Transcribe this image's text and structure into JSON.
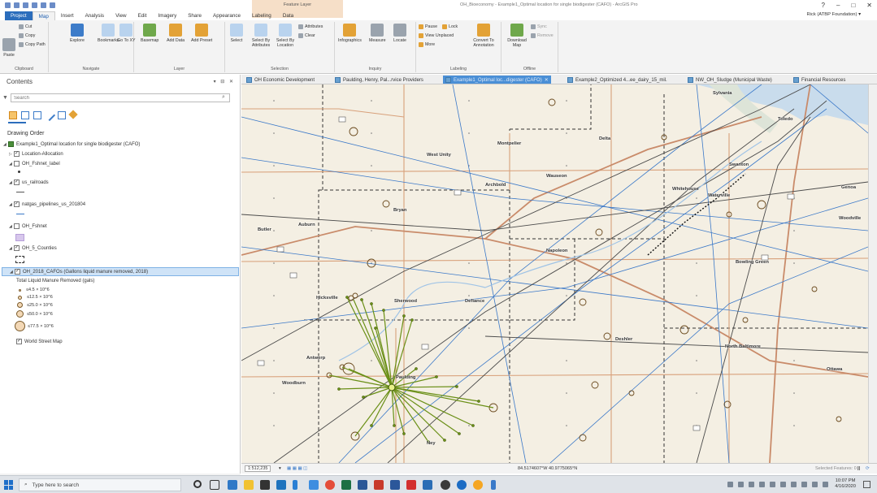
{
  "window": {
    "title": "OH_Bioeconomy - Example1_Optimal location for single biodigester (CAFO) - ArcGIS Pro",
    "context_label": "Feature Layer",
    "help": "?",
    "minimize": "–",
    "maximize": "□",
    "close": "✕"
  },
  "ribbon_tabs": [
    "Project",
    "Map",
    "Insert",
    "Analysis",
    "View",
    "Edit",
    "Imagery",
    "Share",
    "Appearance",
    "Labeling",
    "Data"
  ],
  "active_tab": "Map",
  "user": "Rick (ATBP Foundation) ▾",
  "ribbon": {
    "clipboard": {
      "label": "Clipboard",
      "paste": "Paste",
      "cut": "Cut",
      "copy": "Copy",
      "copy_path": "Copy Path"
    },
    "navigate": {
      "label": "Navigate",
      "explore": "Explore",
      "bookmarks": "Bookmarks",
      "go_to_xy": "Go To XY"
    },
    "layer": {
      "label": "Layer",
      "basemap": "Basemap",
      "add_data": "Add Data",
      "add_preset": "Add Preset"
    },
    "selection": {
      "label": "Selection",
      "select": "Select",
      "select_by_attributes": "Select By Attributes",
      "select_by_location": "Select By Location",
      "attributes": "Attributes",
      "clear": "Clear"
    },
    "inquiry": {
      "label": "Inquiry",
      "infographics": "Infographics",
      "measure": "Measure",
      "locate": "Locate"
    },
    "labeling": {
      "label": "Labeling",
      "pause": "Pause",
      "lock": "Lock",
      "view_unplaced": "View Unplaced",
      "more": "More",
      "convert": "Convert To Annotation"
    },
    "offline": {
      "label": "Offline",
      "download": "Download Map",
      "sync": "Sync",
      "remove": "Remove"
    }
  },
  "contents": {
    "title": "Contents",
    "controls": "▾ ⊟ ✕",
    "search_placeholder": "Search",
    "search_icon": "⌕",
    "drawing_order": "Drawing Order",
    "layers": [
      {
        "name": "Example1_Optimal location for single biodigester (CAFO)",
        "checked": true
      },
      {
        "name": "Location-Allocation",
        "checked": true
      },
      {
        "name": "OH_Fshnet_label",
        "checked": false
      },
      {
        "name": "us_railroads",
        "checked": true
      },
      {
        "name": "natgas_pipelines_us_201804",
        "checked": true
      },
      {
        "name": "OH_Fshnet",
        "checked": false
      },
      {
        "name": "OH_5_Counties",
        "checked": true
      },
      {
        "name": "OH_2018_CAFOs (Gallons liquid manure removed, 2018)",
        "checked": true
      },
      {
        "name": "World Street Map",
        "checked": true
      }
    ],
    "legend_title": "Total Liquid Manure Removed (gals)",
    "legend_items": [
      "≤4.5 × 10^6",
      "≤12.5 × 10^6",
      "≤25.0 × 10^6",
      "≤50.0 × 10^6",
      "≤77.5 × 10^6"
    ]
  },
  "map_tabs": [
    {
      "label": "OH Economic Development",
      "active": false
    },
    {
      "label": "Paulding, Henry, Pal...rvice Providers",
      "active": false
    },
    {
      "label": "Example1_Optimal loc...digester (CAFO)",
      "active": true
    },
    {
      "label": "Example2_Optimized 4...ee_dairy_15_mil.",
      "active": false
    },
    {
      "label": "NW_OH_Sludge (Municipal Waste)",
      "active": false
    },
    {
      "label": "Financial Resources",
      "active": false
    }
  ],
  "map_places": [
    "Montpelier",
    "West Unity",
    "Delta",
    "Archbold",
    "Wauseon",
    "Swanton",
    "Bryan",
    "Whitehouse",
    "Waterville",
    "Napoleon",
    "Defiance",
    "Sherwood",
    "Hicksville",
    "Antwerp",
    "Paulding",
    "Woodburn",
    "Ney",
    "Bowling Green",
    "Deshler",
    "North Baltimore",
    "Ottawa",
    "Toledo",
    "Sylvania",
    "Genoa",
    "Woodville",
    "Butler",
    "Auburn"
  ],
  "status": {
    "scale": "1:512,235",
    "coords": "84.5174607°W 40.9775065°N",
    "selected": "Selected Features: 0"
  },
  "taskbar": {
    "search": "Type here to search",
    "time": "10:07 PM",
    "date": "4/16/2020"
  }
}
